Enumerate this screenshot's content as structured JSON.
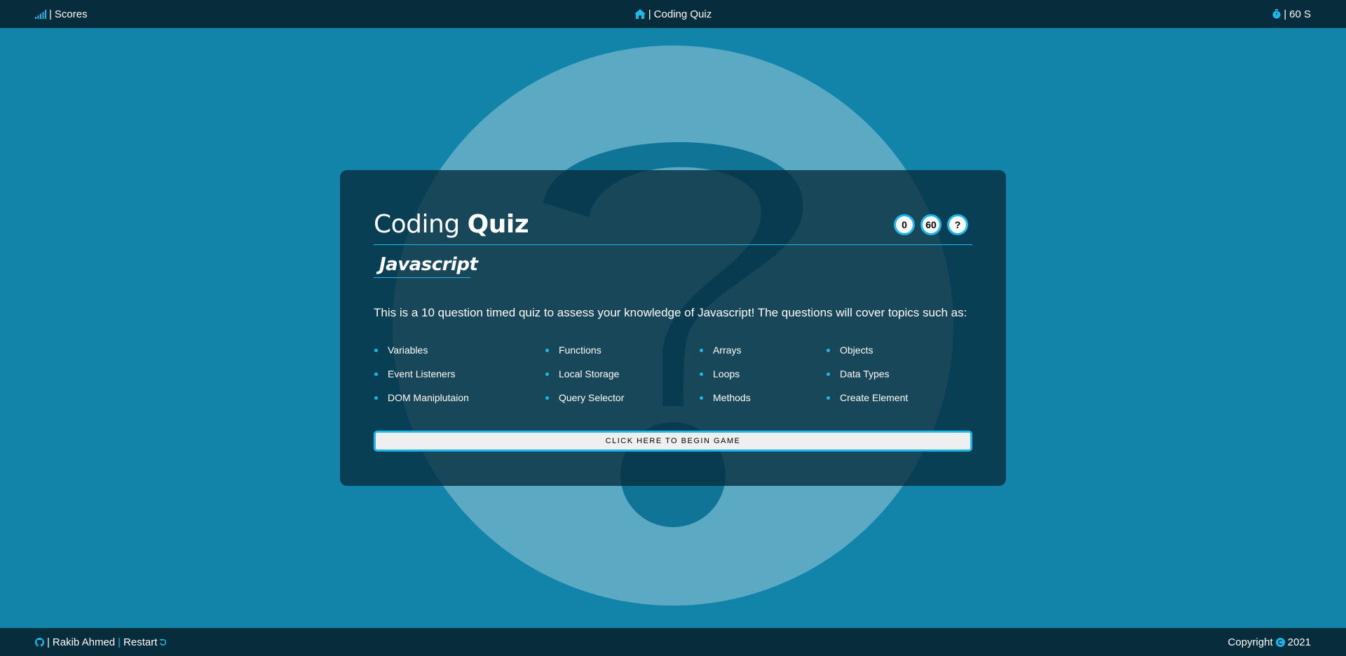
{
  "header": {
    "scores_label": "Scores",
    "separator": "|",
    "home_label": "Coding Quiz",
    "timer_label": "60 S"
  },
  "quiz": {
    "title_light": "Coding",
    "title_bold": "Quiz",
    "badges": {
      "score": "0",
      "time": "60",
      "help": "?"
    },
    "subtitle": "Javascript",
    "intro": "This is a 10 question timed quiz to assess your knowledge of Javascript! The questions will cover topics such as:",
    "topics": [
      "Variables",
      "Functions",
      "Arrays",
      "Objects",
      "Event Listeners",
      "Local Storage",
      "Loops",
      "Data Types",
      "DOM Maniplutaion",
      "Query Selector",
      "Methods",
      "Create Element"
    ],
    "begin_button": "CLICK HERE TO BEGIN GAME"
  },
  "footer": {
    "author": "Rakib Ahmed",
    "separator": "|",
    "restart_label": "Restart",
    "copyright_label": "Copyright",
    "year": "2021"
  },
  "icons": {
    "scores": "signal-bars-icon",
    "home": "home-icon",
    "timer": "stopwatch-icon",
    "github": "github-icon",
    "restart": "undo-icon",
    "copyright": "copyright-icon"
  },
  "colors": {
    "background": "#1283a9",
    "bars": "#072c3c",
    "accent": "#1cb8e8",
    "card": "#072c3c"
  }
}
